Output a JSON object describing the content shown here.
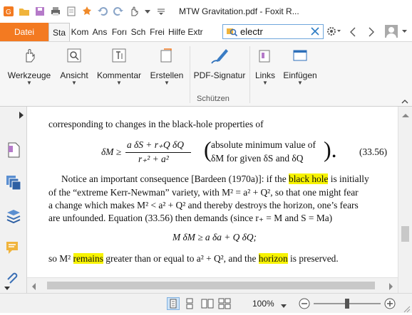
{
  "window": {
    "title": "MTW Gravitation.pdf - Foxit R..."
  },
  "tabs": [
    "Datei",
    "Sta",
    "Kom",
    "Ans",
    "Forı",
    "Sch",
    "Frei",
    "Hilfe",
    "Extr"
  ],
  "search": {
    "value": "electr"
  },
  "ribbon": {
    "buttons": [
      "Werkzeuge",
      "Ansicht",
      "Kommentar",
      "Erstellen",
      "PDF-Signatur",
      "Links",
      "Einfügen"
    ],
    "group_label": "Schützen"
  },
  "document": {
    "line1": "corresponding to changes in the black-hole properties of",
    "eq1_lhs": "δM ≥",
    "eq1_num": "a δS + r₊Q δQ",
    "eq1_den": "r₊² + a²",
    "eq1_note1": "absolute minimum value of",
    "eq1_note2": "δM for given δS and δQ",
    "eq1_number": "(33.56)",
    "p2_l1a": "Notice an important consequence [Bardeen (1970a)]: if the ",
    "p2_l1_hl": "black hole",
    "p2_l1b": " is initially",
    "p2_l2": "of the “extreme Kerr-Newman” variety, with M² = a² + Q², so that one might fear",
    "p2_l3": "a change which makes M² < a² + Q² and thereby destroys the horizon, one’s fears",
    "p2_l4": "are unfounded. Equation (33.56) then demands (since r₊ = M and S = Ma)",
    "eq2": "M δM ≥ a δa + Q δQ;",
    "p3_a": "so M² ",
    "p3_hl1": "remains",
    "p3_b": " greater than or equal to a² + Q², and the ",
    "p3_hl2": "horizon",
    "p3_c": " is preserved."
  },
  "status": {
    "zoom": "100%"
  },
  "colors": {
    "accent": "#f37a21",
    "highlight": "#f7f300",
    "icon_blue": "#3a6fb5"
  }
}
